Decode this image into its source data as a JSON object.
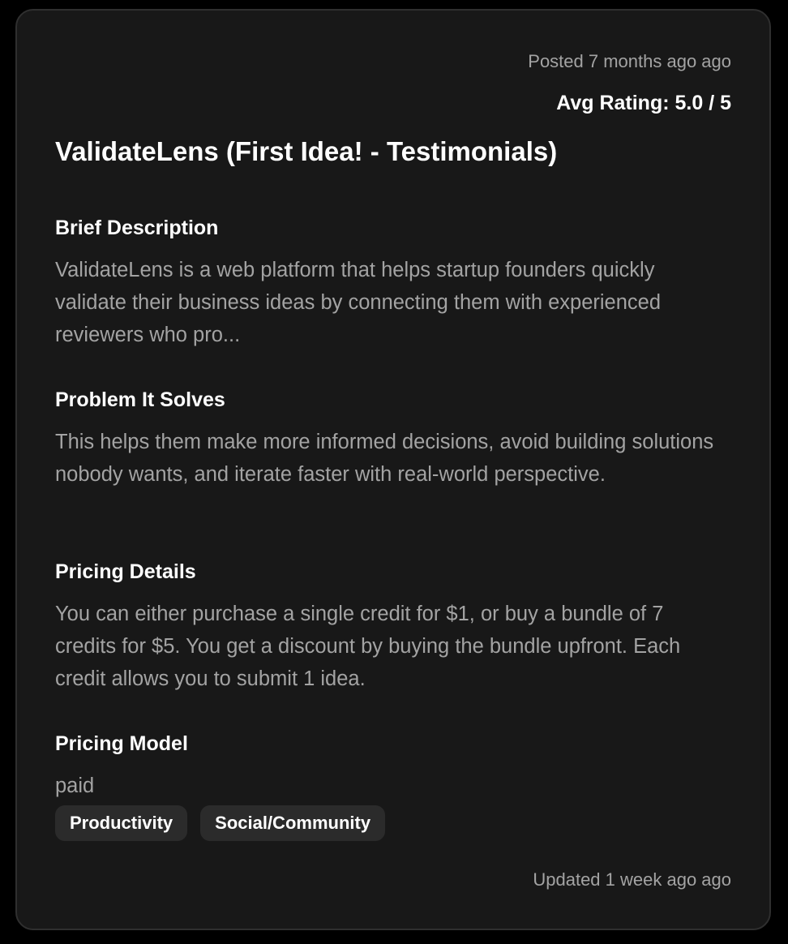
{
  "card": {
    "posted": "Posted 7 months ago ago",
    "rating": "Avg Rating: 5.0 / 5",
    "title": "ValidateLens (First Idea! - Testimonials)",
    "sections": [
      {
        "label": "Brief Description",
        "text": "ValidateLens is a web platform that helps startup founders quickly validate their business ideas by connecting them with experienced reviewers who pro..."
      },
      {
        "label": "Problem It Solves",
        "text": "This helps them make more informed decisions, avoid building solutions nobody wants, and iterate faster with real-world perspective."
      },
      {
        "label": "Pricing Details",
        "text": "You can either purchase a single credit for $1, or buy a bundle of 7 credits for $5. You get a discount by buying the bundle upfront. Each credit allows you to submit 1 idea."
      },
      {
        "label": "Pricing Model",
        "text": "paid"
      }
    ],
    "tags": [
      "Productivity",
      "Social/Community"
    ],
    "updated": "Updated 1 week ago ago"
  },
  "colors": {
    "background": "#000000",
    "card": "#181818",
    "card_border": "#2f2f2f",
    "muted_text": "#a3a3a3",
    "tag_background": "#2b2b2b"
  }
}
